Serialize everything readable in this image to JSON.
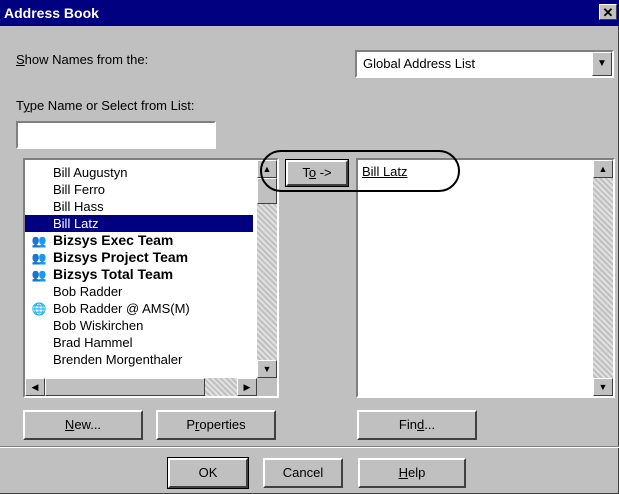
{
  "window": {
    "title": "Address Book",
    "close_glyph": "✕"
  },
  "show_names": {
    "label_prefix": "S",
    "label_rest": "how Names from the:",
    "selected": "Global Address List"
  },
  "type_name": {
    "label_prefix": "T",
    "label_u": "y",
    "label_rest": "pe Name or Select from List:",
    "value": ""
  },
  "names_list": {
    "items": [
      {
        "label": "Bill Augustyn",
        "icon": "",
        "bold": false,
        "selected": false
      },
      {
        "label": "Bill Ferro",
        "icon": "",
        "bold": false,
        "selected": false
      },
      {
        "label": "Bill Hass",
        "icon": "",
        "bold": false,
        "selected": false
      },
      {
        "label": "Bill Latz",
        "icon": "",
        "bold": false,
        "selected": true
      },
      {
        "label": "Bizsys Exec Team",
        "icon": "group-icon",
        "bold": true,
        "selected": false
      },
      {
        "label": "Bizsys Project Team",
        "icon": "group-icon",
        "bold": true,
        "selected": false
      },
      {
        "label": "Bizsys Total Team",
        "icon": "group-icon",
        "bold": true,
        "selected": false
      },
      {
        "label": "Bob Radder",
        "icon": "",
        "bold": false,
        "selected": false
      },
      {
        "label": "Bob Radder @ AMS(M)",
        "icon": "globe-icon",
        "bold": false,
        "selected": false
      },
      {
        "label": "Bob Wiskirchen",
        "icon": "",
        "bold": false,
        "selected": false
      },
      {
        "label": "Brad Hammel",
        "icon": "",
        "bold": false,
        "selected": false
      },
      {
        "label": "Brenden Morgenthaler",
        "icon": "",
        "bold": false,
        "selected": false
      }
    ]
  },
  "to_button": {
    "label_pre": "T",
    "label_u": "o",
    "label_post": " ->"
  },
  "recipients": {
    "entry": "Bill Latz"
  },
  "buttons": {
    "new_u": "N",
    "new_rest": "ew...",
    "properties_pre": "P",
    "properties_u": "r",
    "properties_rest": "operties",
    "find_pre": "Fin",
    "find_u": "d",
    "find_rest": "...",
    "ok": "OK",
    "cancel": "Cancel",
    "help_u": "H",
    "help_rest": "elp"
  }
}
